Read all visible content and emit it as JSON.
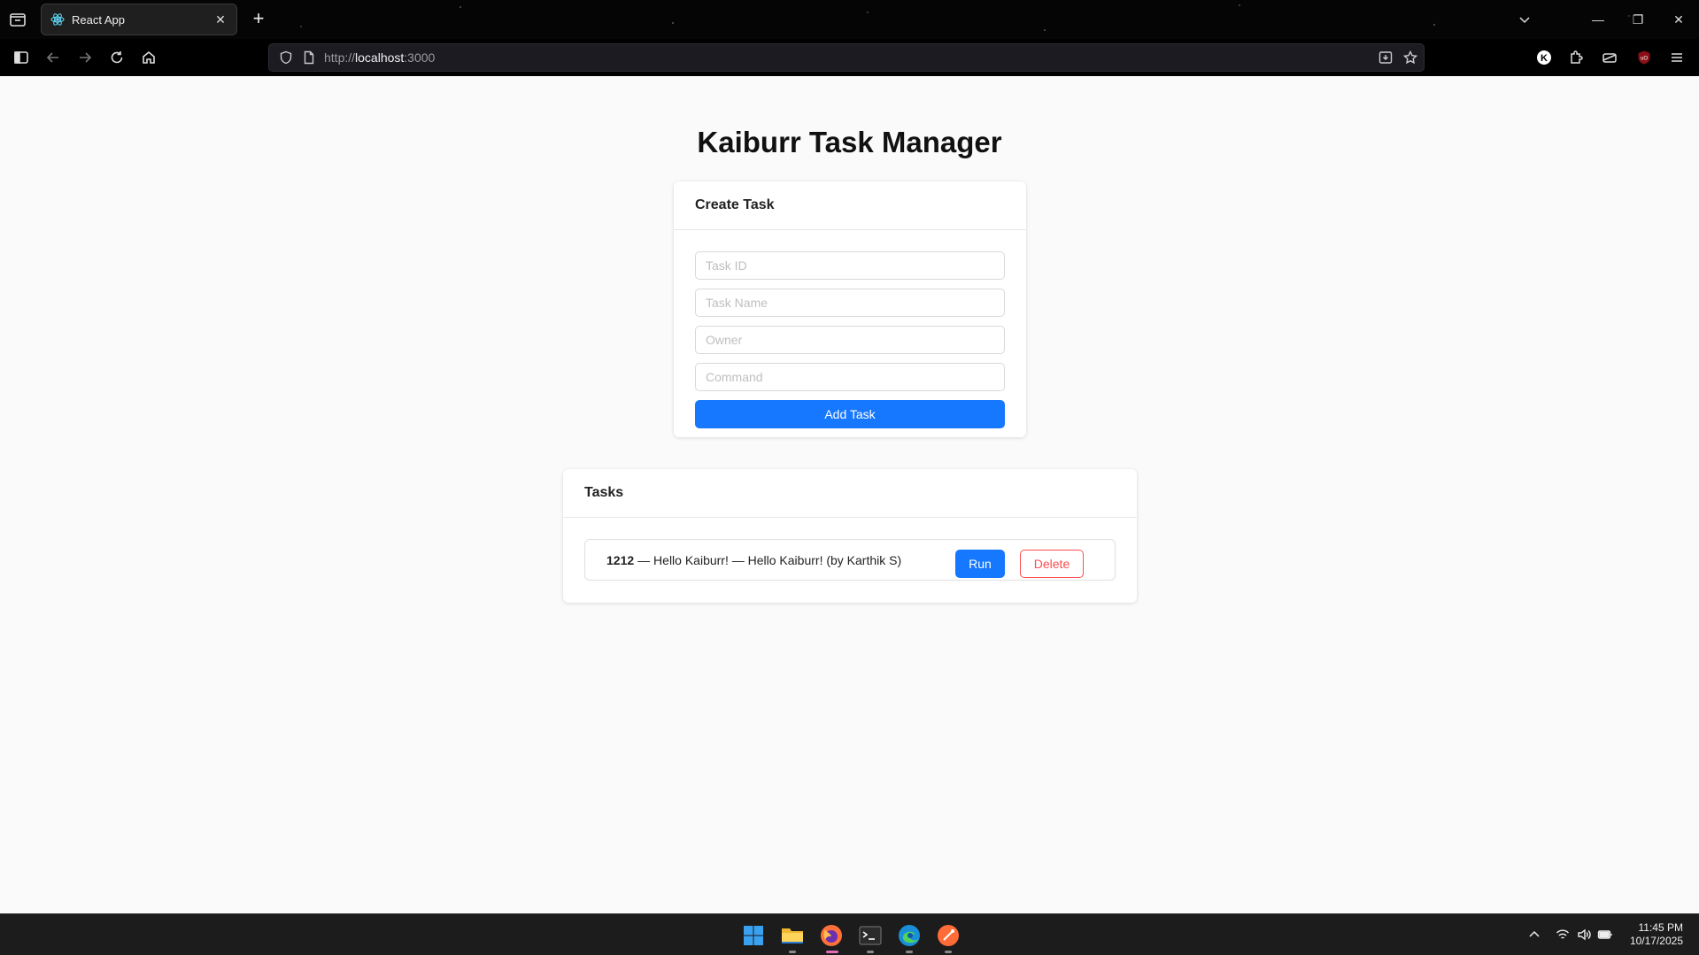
{
  "browser": {
    "tab_title": "React App",
    "url_protocol": "http://",
    "url_host": "localhost",
    "url_port": ":3000"
  },
  "page": {
    "title": "Kaiburr Task Manager"
  },
  "create_task": {
    "header": "Create Task",
    "task_id_placeholder": "Task ID",
    "task_name_placeholder": "Task Name",
    "owner_placeholder": "Owner",
    "command_placeholder": "Command",
    "add_button": "Add Task"
  },
  "tasks": {
    "header": "Tasks",
    "items": [
      {
        "id": "1212",
        "description": "— Hello Kaiburr! — Hello Kaiburr! (by Karthik S)",
        "run_label": "Run",
        "delete_label": "Delete"
      }
    ]
  },
  "taskbar": {
    "time": "11:45 PM",
    "date": "10/17/2025"
  },
  "colors": {
    "primary": "#1677ff",
    "danger": "#ff4d4f",
    "page_bg": "#fafafa"
  }
}
